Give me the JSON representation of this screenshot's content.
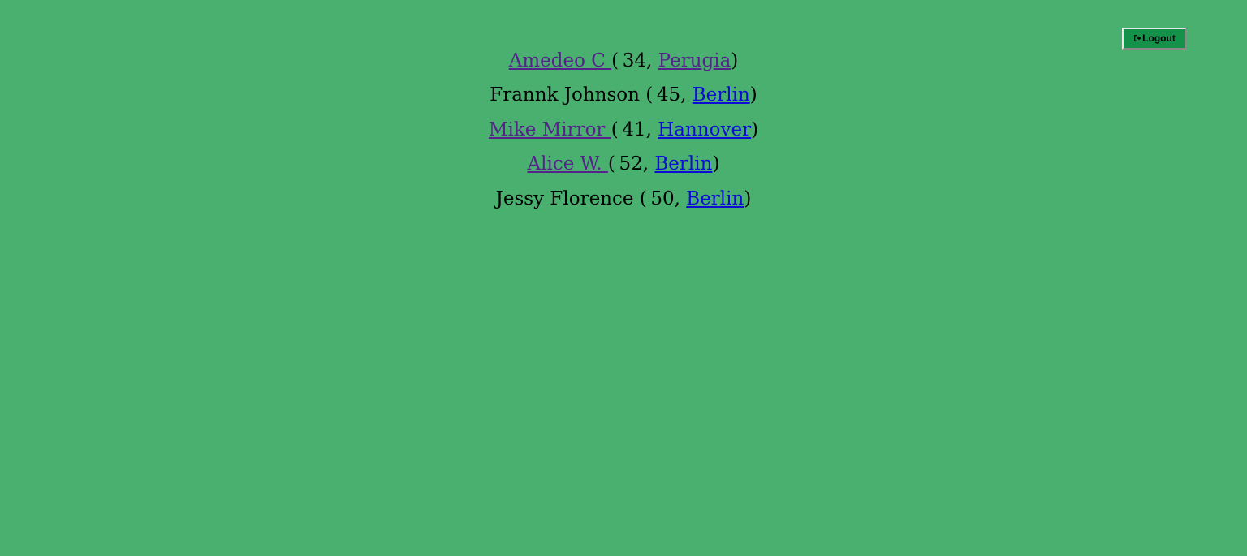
{
  "header": {
    "logout_label": "Logout"
  },
  "people": [
    {
      "name": "Amedeo C ",
      "name_is_link": true,
      "age": "34",
      "city": "Perugia",
      "city_visited": true
    },
    {
      "name": "Frannk Johnson ",
      "name_is_link": false,
      "age": "45",
      "city": "Berlin",
      "city_visited": false
    },
    {
      "name": "Mike Mirror ",
      "name_is_link": true,
      "age": "41",
      "city": "Hannover",
      "city_visited": false
    },
    {
      "name": "Alice W. ",
      "name_is_link": true,
      "age": "52",
      "city": "Berlin",
      "city_visited": false
    },
    {
      "name": "Jessy Florence ",
      "name_is_link": false,
      "age": "50",
      "city": "Berlin",
      "city_visited": false
    }
  ],
  "colors": {
    "background": "#4ab06f",
    "button": "#14924a",
    "visited_link": "#55238a",
    "unvisited_link": "#0d0bd6"
  },
  "icons": {
    "logout": "sign-out-icon"
  }
}
